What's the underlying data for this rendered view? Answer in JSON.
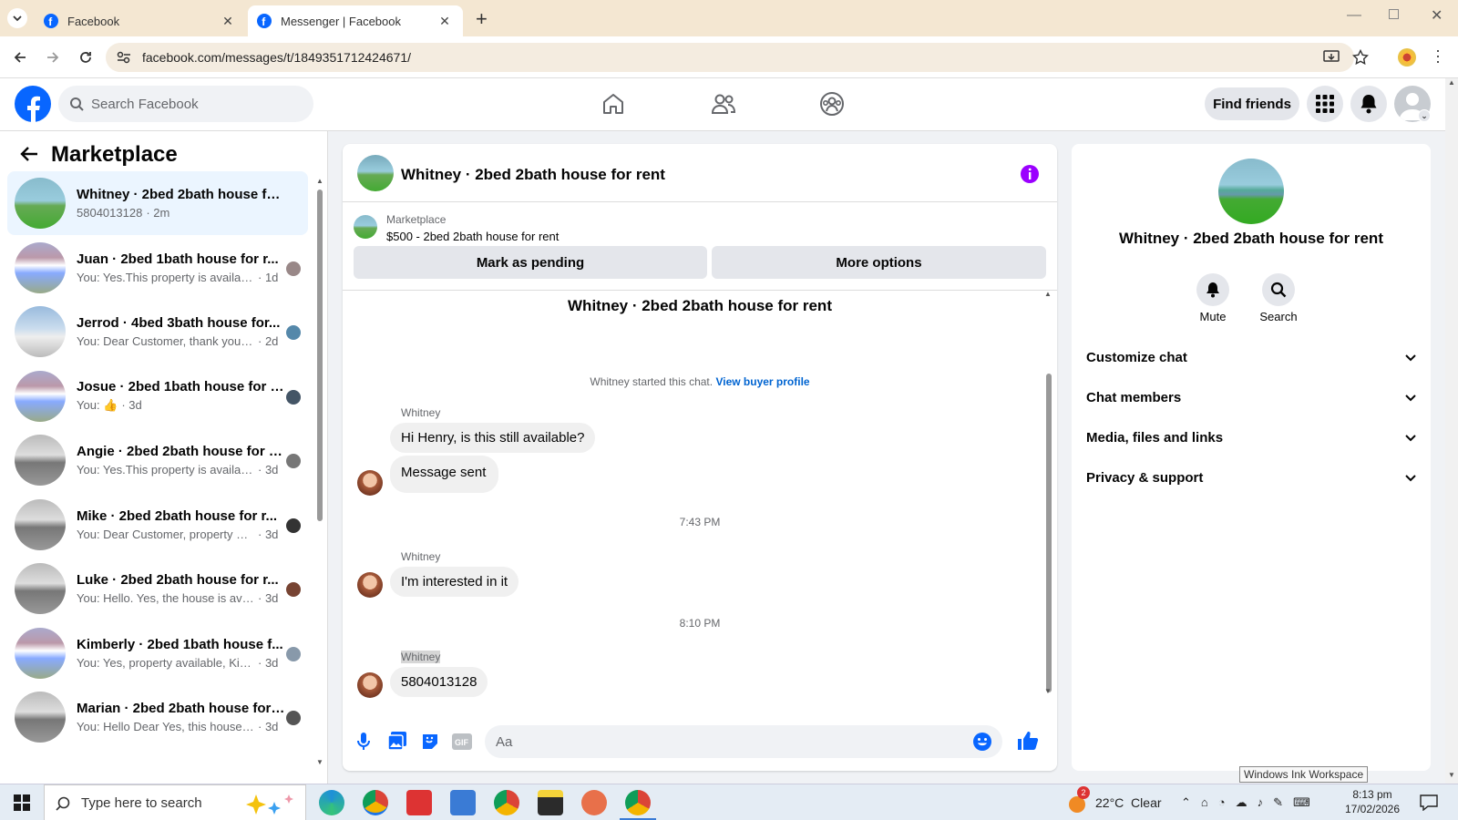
{
  "browser": {
    "tabs": [
      {
        "title": "Facebook",
        "active": false
      },
      {
        "title": "Messenger | Facebook",
        "active": true
      }
    ],
    "url": "facebook.com/messages/t/1849351712424671/"
  },
  "header": {
    "search_placeholder": "Search Facebook",
    "find_friends": "Find friends"
  },
  "sidebar": {
    "title": "Marketplace",
    "conversations": [
      {
        "name": "Whitney · 2bed 2bath house for ...",
        "preview": "5804013128",
        "time": "· 2m",
        "active": true
      },
      {
        "name": "Juan · 2bed 1bath house for r...",
        "preview": "You: Yes.This property is availabl...",
        "time": "· 1d"
      },
      {
        "name": "Jerrod · 4bed 3bath house for...",
        "preview": "You: Dear Customer, thank you f...",
        "time": "· 2d"
      },
      {
        "name": "Josue · 2bed 1bath house for r...",
        "preview": "You: 👍",
        "time": "· 3d"
      },
      {
        "name": "Angie · 2bed 2bath house for rent",
        "preview": "You: Yes.This property is available n...",
        "time": "· 3d"
      },
      {
        "name": "Mike · 2bed 2bath house for r...",
        "preview": "You: Dear Customer, property av...",
        "time": "· 3d"
      },
      {
        "name": "Luke · 2bed 2bath house for r...",
        "preview": "You: Hello. Yes, the house is avail...",
        "time": "· 3d"
      },
      {
        "name": "Kimberly · 2bed 1bath house f...",
        "preview": "You: Yes, property available, Kind...",
        "time": "· 3d"
      },
      {
        "name": "Marian · 2bed 2bath house for r...",
        "preview": "You: Hello Dear Yes, this house is av...",
        "time": "· 3d"
      }
    ]
  },
  "chat": {
    "title": "Whitney · 2bed 2bath house for rent",
    "listing_source": "Marketplace",
    "listing_detail": "$500 - 2bed 2bath house for rent",
    "mark_pending": "Mark as pending",
    "more_options": "More options",
    "thread_title": "Whitney · 2bed 2bath house for rent",
    "started_text": "Whitney started this chat.",
    "view_buyer": "View buyer profile",
    "messages": [
      {
        "sender": "Whitney",
        "texts": [
          "Hi Henry, is this still available?",
          "Message sent"
        ]
      },
      {
        "time": "7:43 PM"
      },
      {
        "sender": "Whitney",
        "texts": [
          "I'm interested in it"
        ]
      },
      {
        "time": "8:10 PM"
      },
      {
        "sender": "Whitney",
        "texts": [
          "5804013128"
        ]
      }
    ],
    "input_placeholder": "Aa"
  },
  "info": {
    "name": "Whitney · 2bed 2bath house for rent",
    "mute": "Mute",
    "search": "Search",
    "sections": [
      "Customize chat",
      "Chat members",
      "Media, files and links",
      "Privacy & support"
    ]
  },
  "tooltip": "Windows Ink Workspace",
  "taskbar": {
    "search_placeholder": "Type here to search",
    "weather": "22°C  Clear",
    "weather_badge": "2",
    "time": "8:13 pm",
    "date": "17/02/2026"
  },
  "colors": {
    "fb_blue": "#0866ff",
    "accent_purple": "#9b00ff",
    "tab_bg": "#f4e7d2"
  }
}
